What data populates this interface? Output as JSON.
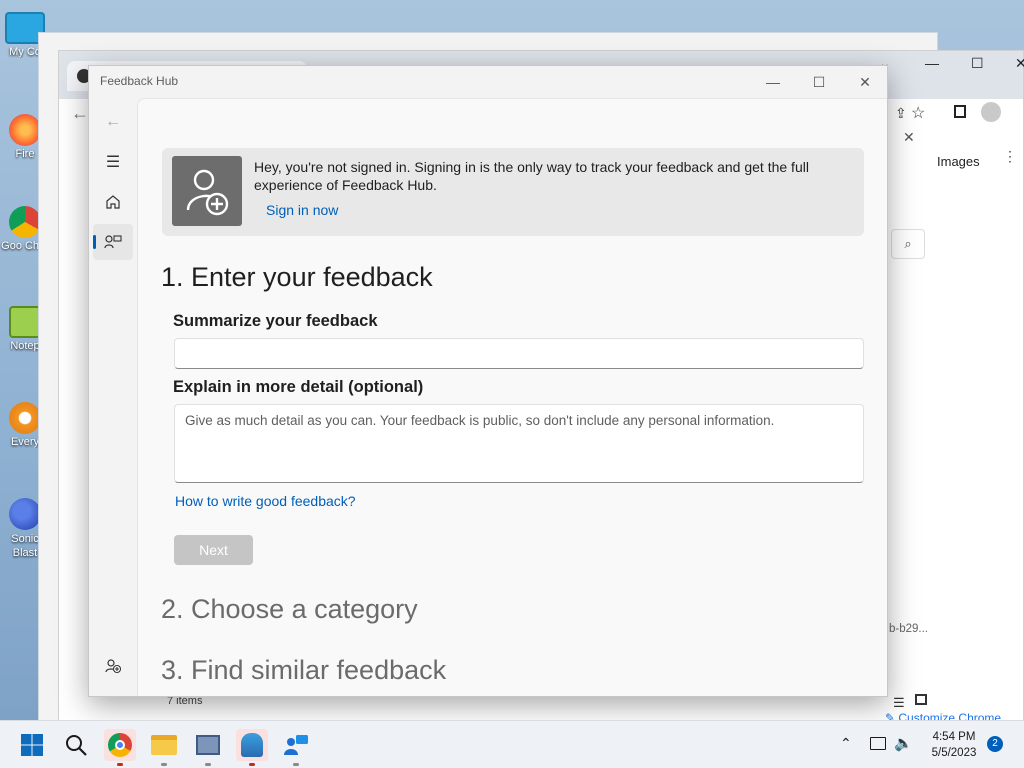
{
  "desktop": {
    "icons": [
      {
        "label": "My Co"
      },
      {
        "label": "Fire"
      },
      {
        "label": "Goo Chro"
      },
      {
        "label": "Notep"
      },
      {
        "label": "Every"
      },
      {
        "label": "Sonic Blast"
      }
    ]
  },
  "bg_browser": {
    "images_label": "Images",
    "truncated_id": "b-b29...",
    "items_count": "7 items",
    "customize_label": "Customize Chrome"
  },
  "window": {
    "title": "Feedback Hub"
  },
  "banner": {
    "message": "Hey, you're not signed in. Signing in is the only way to track your feedback and get the full experience of Feedback Hub.",
    "sign_in_link": "Sign in now"
  },
  "form": {
    "step1_title": "1. Enter your feedback",
    "summary_label": "Summarize your feedback",
    "summary_value": "",
    "detail_label": "Explain in more detail (optional)",
    "detail_placeholder": "Give as much detail as you can. Your feedback is public, so don't include any personal information.",
    "help_link": "How to write good feedback?",
    "next_label": "Next",
    "step2_title": "2. Choose a category",
    "step3_title": "3. Find similar feedback"
  },
  "taskbar": {
    "time": "4:54 PM",
    "date": "5/5/2023",
    "notification_count": "2"
  },
  "colors": {
    "accent": "#005fb8",
    "disabled_button": "#c5c5c5"
  }
}
